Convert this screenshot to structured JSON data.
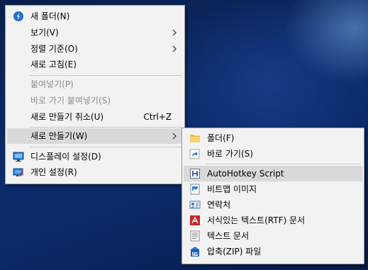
{
  "main_menu": {
    "items": [
      {
        "label": "새 폴더(N)",
        "icon": "new-folder-icon"
      },
      {
        "label": "보기(V)"
      },
      {
        "label": "정렬 기준(O)"
      },
      {
        "label": "새로 고침(E)"
      },
      {
        "label": "붙여넣기(P)"
      },
      {
        "label": "바로 가기 붙여넣기(S)"
      },
      {
        "label": "새로 만들기 취소(U)",
        "shortcut": "Ctrl+Z"
      },
      {
        "label": "새로 만들기(W)"
      },
      {
        "label": "디스플레이 설정(D)",
        "icon": "display-settings-icon"
      },
      {
        "label": "개인 설정(R)",
        "icon": "personalize-icon"
      }
    ]
  },
  "sub_menu": {
    "items": [
      {
        "label": "폴더(F)",
        "icon": "folder-icon"
      },
      {
        "label": "바로 가기(S)",
        "icon": "shortcut-icon"
      },
      {
        "label": "AutoHotkey Script",
        "icon": "autohotkey-icon"
      },
      {
        "label": "비트맵 이미지",
        "icon": "bitmap-image-icon"
      },
      {
        "label": "연락처",
        "icon": "contact-icon"
      },
      {
        "label": "서식있는 텍스트(RTF) 문서",
        "icon": "rtf-document-icon"
      },
      {
        "label": "텍스트 문서",
        "icon": "text-document-icon"
      },
      {
        "label": "압축(ZIP) 파일",
        "icon": "zip-folder-icon"
      }
    ]
  },
  "colors": {
    "menu_bg": "#f2f2f2",
    "highlight": "#d9d9d9",
    "disabled_text": "#8c8c8c"
  }
}
